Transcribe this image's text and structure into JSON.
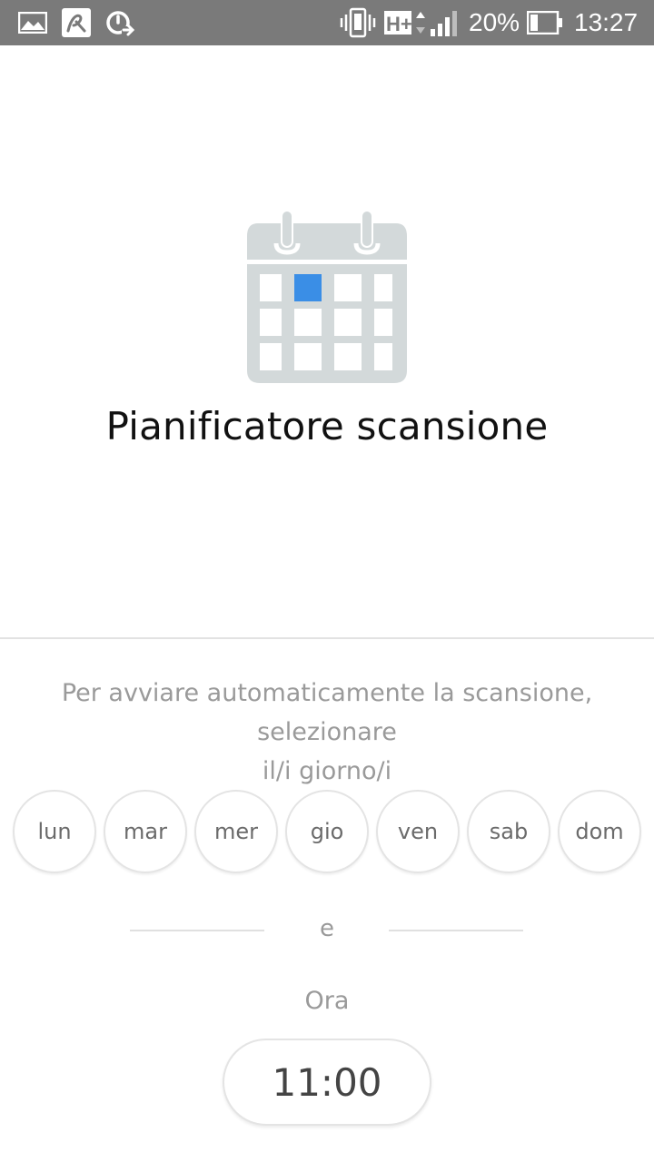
{
  "status_bar": {
    "icons": [
      "gallery-icon",
      "avira-icon",
      "speedometer-icon",
      "vibrate-icon",
      "hplus-network-icon",
      "signal-icon",
      "battery-icon"
    ],
    "network": "H+",
    "battery": "20%",
    "time": "13:27"
  },
  "hero": {
    "icon": "calendar-icon",
    "title": "Pianificatore scansione",
    "accent_color": "#3a8ee6",
    "icon_color": "#d3d9da"
  },
  "schedule": {
    "instruction_line1": "Per avviare automaticamente la scansione, selezionare",
    "instruction_line2": "il/i giorno/i",
    "days": [
      "lun",
      "mar",
      "mer",
      "gio",
      "ven",
      "sab",
      "dom"
    ],
    "separator": "e",
    "time_label": "Ora",
    "time_value": "11:00"
  }
}
